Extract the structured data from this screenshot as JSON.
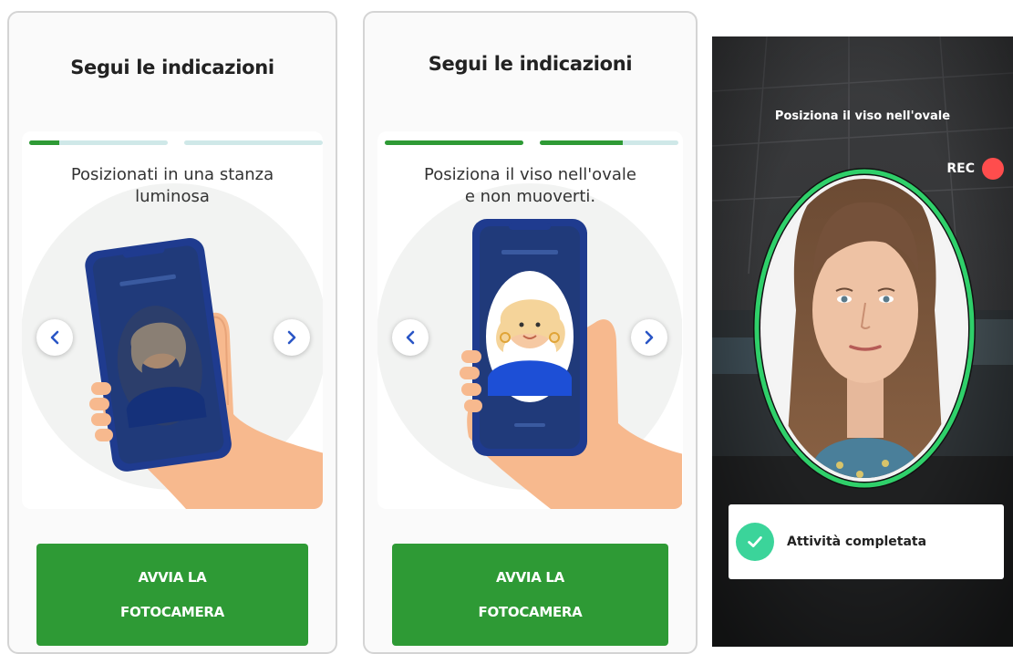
{
  "screen1": {
    "title": "Segui le indicazioni",
    "progress": [
      0.22,
      0.0
    ],
    "instruction": "Posizionati in una stanza\nluminosa",
    "button_line1": "AVVIA LA",
    "button_line2": "FOTOCAMERA"
  },
  "screen2": {
    "title": "Segui le indicazioni",
    "progress": [
      1.0,
      0.6
    ],
    "instruction": "Posiziona il viso nell'ovale\ne non muoverti.",
    "button_line1": "AVVIA LA",
    "button_line2": "FOTOCAMERA"
  },
  "camera": {
    "title": "Posiziona il viso nell'ovale",
    "rec_label": "REC",
    "toast_text": "Attività completata"
  },
  "icons": [
    "chevron-left-icon",
    "chevron-right-icon",
    "check-icon",
    "record-dot-icon"
  ],
  "colors": {
    "primary_green": "#2e9a35",
    "progress_track": "#cfe8e8",
    "phone_blue": "#1f3b8f",
    "rec_red": "#ff4d4d",
    "success_teal": "#3bd49a",
    "oval_green": "#2fd06a"
  }
}
